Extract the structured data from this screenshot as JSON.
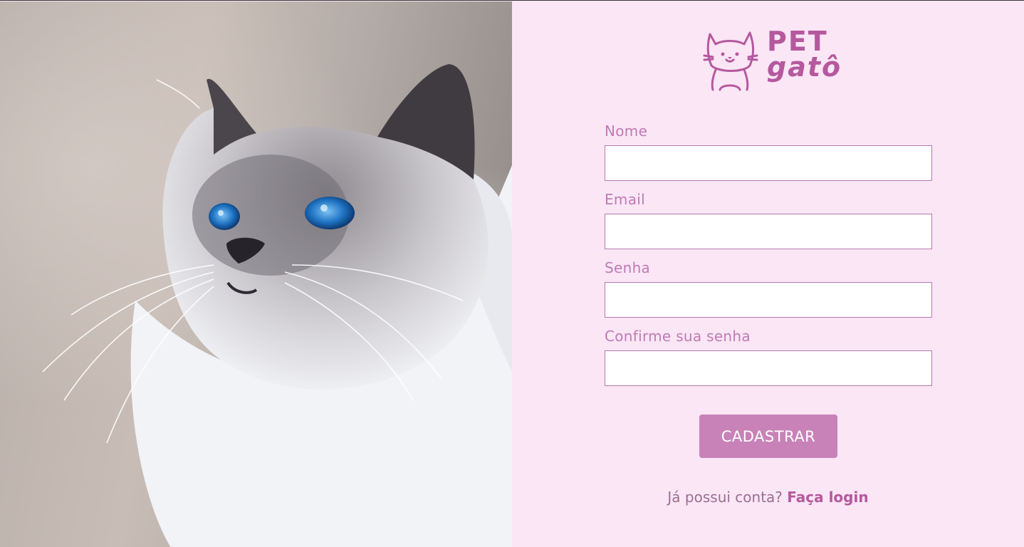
{
  "photo": {
    "alt": "cat"
  },
  "brand": {
    "line1": "PET",
    "line2": "gatô",
    "color": "#b5589e"
  },
  "form": {
    "fields": [
      {
        "label": "Nome",
        "value": ""
      },
      {
        "label": "Email",
        "value": ""
      },
      {
        "label": "Senha",
        "value": ""
      },
      {
        "label": "Confirme sua senha",
        "value": ""
      }
    ],
    "submit_label": "CADASTRAR"
  },
  "footer": {
    "prompt": "Já possui conta? ",
    "link_label": "Faça login"
  },
  "colors": {
    "background": "#fae6f5",
    "accent": "#c882b8",
    "label": "#c07ab6"
  }
}
